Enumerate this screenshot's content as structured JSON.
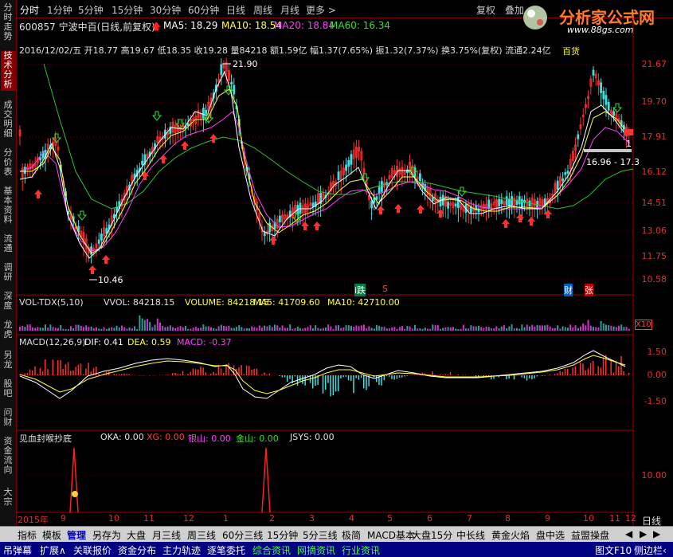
{
  "toolbar": {
    "periods": [
      "分时",
      "1分钟",
      "5分钟",
      "15分钟",
      "30分钟",
      "60分钟",
      "日线",
      "周线",
      "月线",
      "更多 >"
    ],
    "active_period": "分时",
    "fuquan_label": "复权",
    "overlay_label": "叠加"
  },
  "watermark": {
    "title": "分析家公式网",
    "url": "www.88gs.com"
  },
  "side_tabs": [
    "分时走势",
    "技术分析",
    "成交明细",
    "分价表",
    "基本资料",
    "流通",
    "调研",
    "深度",
    "龙虎",
    "另龙",
    "股吧",
    "问财",
    "资金流向",
    "大宗"
  ],
  "stock": {
    "code_name": "600857 宁波中百(日线,前复权)",
    "ma5": "MA5: 18.29",
    "ma10": "MA10: 18.54",
    "ma20": "MA20: 18.84",
    "ma60": "MA60: 16.34",
    "info": "2016/12/02/五 开18.77 高19.67 低18.35 收19.28 量84218 额1.59亿 幅1.37(7.65%) 振1.32(7.37%) 换3.75%(复权) 流通2.24亿",
    "sector": "百货",
    "high_mark": "21.90",
    "low_mark": "10.46",
    "range_label": "16.96 - 17.3",
    "last_mark": "1"
  },
  "price_axis": [
    "21.67",
    "19.70",
    "17.91",
    "16.12",
    "14.51",
    "13.06",
    "11.75",
    "10.58"
  ],
  "event_labels": {
    "i": "i跌",
    "s": "S",
    "cai": "财",
    "zhang": "张"
  },
  "volume_panel": {
    "title": "VOL-TDX(5,10)",
    "vvol": "VVOL: 84218.15",
    "volume": "VOLUME: 84218.15",
    "ma5": "MA5: 41709.60",
    "ma10": "MA10: 42710.00",
    "scale": "X10"
  },
  "macd_panel": {
    "title": "MACD(12,26,9)",
    "dif": "DIF: 0.41",
    "dea": "DEA: 0.59",
    "macd": "MACD: -0.37",
    "axis": [
      "1.50",
      "0.00",
      "-1.50"
    ]
  },
  "bottom_indicator": {
    "title": "见血封喉抄底",
    "oka": "OKA: 0.00",
    "xg": "XG: 0.00",
    "yinshan": "银山: 0.00",
    "jinshan": "金山: 0.00",
    "jsys": "JSYS: 0.00",
    "axis": "10.00"
  },
  "time_axis": [
    "2015年",
    "9",
    "10",
    "11",
    "12",
    "1",
    "2",
    "3",
    "4",
    "5",
    "6",
    "7",
    "8",
    "9",
    "10",
    "11",
    "12"
  ],
  "right_corner": "日线",
  "bottom_tabs": [
    "指标",
    "模板",
    "管理",
    "另存为",
    "大盘",
    "月三线",
    "周三线",
    "60分三线",
    "15分钟",
    "5分三线",
    "极简",
    "MACD基本",
    "大盘15分",
    "中长线",
    "黄金火焰",
    "盘中选",
    "益盟操盘"
  ],
  "active_bottom_tab": "管理",
  "link_tabs": [
    "吊弹幕",
    "扩展∧",
    "关联报价",
    "资金分布",
    "主力轨迹",
    "逐笔委托",
    "综合资讯",
    "网摘资讯",
    "行业资讯"
  ],
  "status": {
    "f10": "图文F10",
    "sidebar": "侧边栏‹"
  },
  "colors": {
    "up": "#ff3030",
    "down": "#40e0e0",
    "ma5": "#ffffff",
    "ma10": "#ffff40",
    "ma20": "#ff40ff",
    "ma60": "#30e030",
    "axis": "#a00000"
  }
}
